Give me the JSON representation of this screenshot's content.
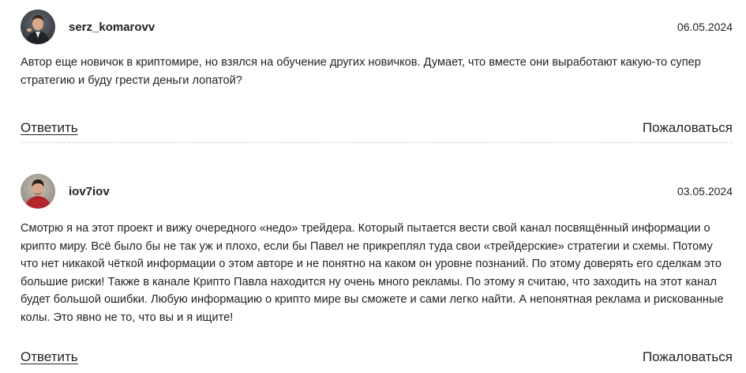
{
  "comments": [
    {
      "username": "serz_komarovv",
      "date": "06.05.2024",
      "avatar_icon": "user-photo-avatar",
      "text": "Автор еще новичок в криптомире, но взялся на обучение других новичков. Думает, что вместе они выработают какую-то супер стратегию и буду грести деньги лопатой?",
      "reply_label": "Ответить",
      "complain_label": "Пожаловаться"
    },
    {
      "username": "iov7iov",
      "date": "03.05.2024",
      "avatar_icon": "user-photo-avatar",
      "text": "Смотрю я на этот проект и вижу очередного «недо» трейдера. Который пытается вести свой канал посвящённый информации о крипто миру. Всё было бы не так уж и плохо, если бы Павел не прикреплял туда свои «трейдерские» стратегии и схемы. Потому что нет никакой чёткой информации о этом авторе и не понятно на каком он уровне познаний. По этому доверять его сделкам это большие риски! Также в канале Крипто Павла находится ну очень много рекламы. По этому я считаю, что заходить на этот канал будет большой ошибки. Любую информацию о крипто мире вы сможете и сами легко найти. А непонятная реклама и рискованные колы. Это явно не то, что вы и я ищите!",
      "reply_label": "Ответить",
      "complain_label": "Пожаловаться"
    }
  ]
}
